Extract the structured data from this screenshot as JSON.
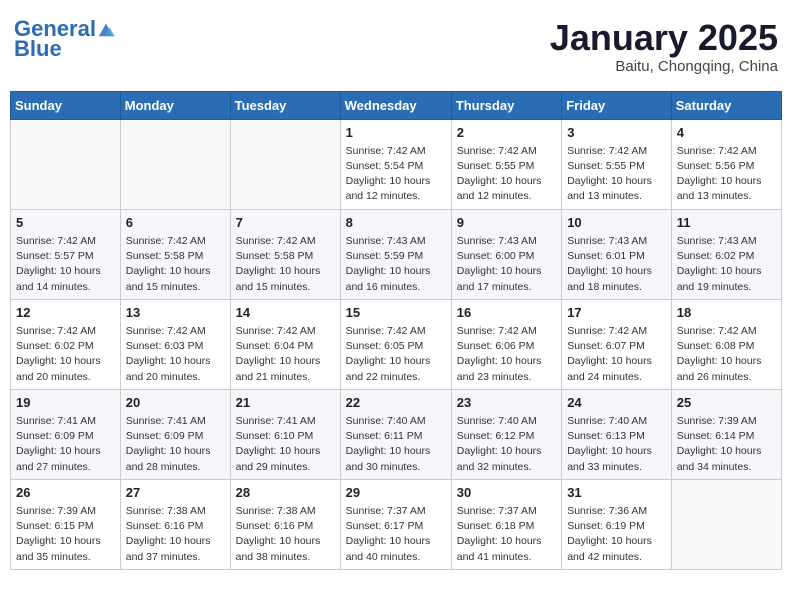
{
  "logo": {
    "line1": "General",
    "line2": "Blue"
  },
  "title": "January 2025",
  "subtitle": "Baitu, Chongqing, China",
  "weekdays": [
    "Sunday",
    "Monday",
    "Tuesday",
    "Wednesday",
    "Thursday",
    "Friday",
    "Saturday"
  ],
  "weeks": [
    [
      {
        "day": "",
        "info": ""
      },
      {
        "day": "",
        "info": ""
      },
      {
        "day": "",
        "info": ""
      },
      {
        "day": "1",
        "info": "Sunrise: 7:42 AM\nSunset: 5:54 PM\nDaylight: 10 hours\nand 12 minutes."
      },
      {
        "day": "2",
        "info": "Sunrise: 7:42 AM\nSunset: 5:55 PM\nDaylight: 10 hours\nand 12 minutes."
      },
      {
        "day": "3",
        "info": "Sunrise: 7:42 AM\nSunset: 5:55 PM\nDaylight: 10 hours\nand 13 minutes."
      },
      {
        "day": "4",
        "info": "Sunrise: 7:42 AM\nSunset: 5:56 PM\nDaylight: 10 hours\nand 13 minutes."
      }
    ],
    [
      {
        "day": "5",
        "info": "Sunrise: 7:42 AM\nSunset: 5:57 PM\nDaylight: 10 hours\nand 14 minutes."
      },
      {
        "day": "6",
        "info": "Sunrise: 7:42 AM\nSunset: 5:58 PM\nDaylight: 10 hours\nand 15 minutes."
      },
      {
        "day": "7",
        "info": "Sunrise: 7:42 AM\nSunset: 5:58 PM\nDaylight: 10 hours\nand 15 minutes."
      },
      {
        "day": "8",
        "info": "Sunrise: 7:43 AM\nSunset: 5:59 PM\nDaylight: 10 hours\nand 16 minutes."
      },
      {
        "day": "9",
        "info": "Sunrise: 7:43 AM\nSunset: 6:00 PM\nDaylight: 10 hours\nand 17 minutes."
      },
      {
        "day": "10",
        "info": "Sunrise: 7:43 AM\nSunset: 6:01 PM\nDaylight: 10 hours\nand 18 minutes."
      },
      {
        "day": "11",
        "info": "Sunrise: 7:43 AM\nSunset: 6:02 PM\nDaylight: 10 hours\nand 19 minutes."
      }
    ],
    [
      {
        "day": "12",
        "info": "Sunrise: 7:42 AM\nSunset: 6:02 PM\nDaylight: 10 hours\nand 20 minutes."
      },
      {
        "day": "13",
        "info": "Sunrise: 7:42 AM\nSunset: 6:03 PM\nDaylight: 10 hours\nand 20 minutes."
      },
      {
        "day": "14",
        "info": "Sunrise: 7:42 AM\nSunset: 6:04 PM\nDaylight: 10 hours\nand 21 minutes."
      },
      {
        "day": "15",
        "info": "Sunrise: 7:42 AM\nSunset: 6:05 PM\nDaylight: 10 hours\nand 22 minutes."
      },
      {
        "day": "16",
        "info": "Sunrise: 7:42 AM\nSunset: 6:06 PM\nDaylight: 10 hours\nand 23 minutes."
      },
      {
        "day": "17",
        "info": "Sunrise: 7:42 AM\nSunset: 6:07 PM\nDaylight: 10 hours\nand 24 minutes."
      },
      {
        "day": "18",
        "info": "Sunrise: 7:42 AM\nSunset: 6:08 PM\nDaylight: 10 hours\nand 26 minutes."
      }
    ],
    [
      {
        "day": "19",
        "info": "Sunrise: 7:41 AM\nSunset: 6:09 PM\nDaylight: 10 hours\nand 27 minutes."
      },
      {
        "day": "20",
        "info": "Sunrise: 7:41 AM\nSunset: 6:09 PM\nDaylight: 10 hours\nand 28 minutes."
      },
      {
        "day": "21",
        "info": "Sunrise: 7:41 AM\nSunset: 6:10 PM\nDaylight: 10 hours\nand 29 minutes."
      },
      {
        "day": "22",
        "info": "Sunrise: 7:40 AM\nSunset: 6:11 PM\nDaylight: 10 hours\nand 30 minutes."
      },
      {
        "day": "23",
        "info": "Sunrise: 7:40 AM\nSunset: 6:12 PM\nDaylight: 10 hours\nand 32 minutes."
      },
      {
        "day": "24",
        "info": "Sunrise: 7:40 AM\nSunset: 6:13 PM\nDaylight: 10 hours\nand 33 minutes."
      },
      {
        "day": "25",
        "info": "Sunrise: 7:39 AM\nSunset: 6:14 PM\nDaylight: 10 hours\nand 34 minutes."
      }
    ],
    [
      {
        "day": "26",
        "info": "Sunrise: 7:39 AM\nSunset: 6:15 PM\nDaylight: 10 hours\nand 35 minutes."
      },
      {
        "day": "27",
        "info": "Sunrise: 7:38 AM\nSunset: 6:16 PM\nDaylight: 10 hours\nand 37 minutes."
      },
      {
        "day": "28",
        "info": "Sunrise: 7:38 AM\nSunset: 6:16 PM\nDaylight: 10 hours\nand 38 minutes."
      },
      {
        "day": "29",
        "info": "Sunrise: 7:37 AM\nSunset: 6:17 PM\nDaylight: 10 hours\nand 40 minutes."
      },
      {
        "day": "30",
        "info": "Sunrise: 7:37 AM\nSunset: 6:18 PM\nDaylight: 10 hours\nand 41 minutes."
      },
      {
        "day": "31",
        "info": "Sunrise: 7:36 AM\nSunset: 6:19 PM\nDaylight: 10 hours\nand 42 minutes."
      },
      {
        "day": "",
        "info": ""
      }
    ]
  ]
}
